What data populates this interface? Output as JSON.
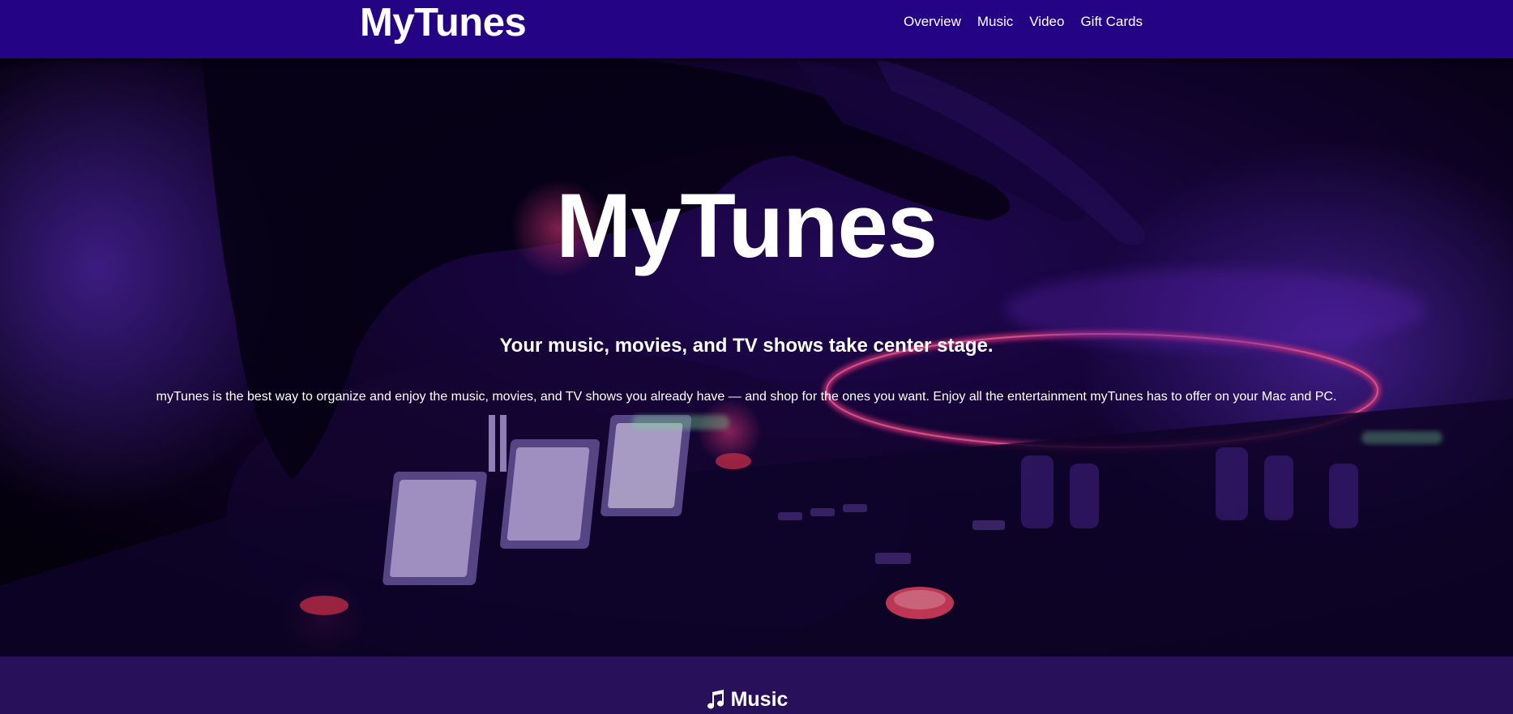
{
  "header": {
    "brand": "MyTunes",
    "nav": [
      "Overview",
      "Music",
      "Video",
      "Gift Cards"
    ]
  },
  "hero": {
    "title": "MyTunes",
    "tagline": "Your music, movies, and TV shows take center stage.",
    "description": "myTunes is the best way to organize and enjoy the music, movies, and TV shows you already have — and shop for the ones you want. Enjoy all the entertainment myTunes has to offer on your Mac and PC."
  },
  "sections": {
    "music": {
      "icon": "music-note-icon",
      "heading": "Music"
    }
  },
  "colors": {
    "navbar": "#250385",
    "music_section": "#28115a",
    "text": "#ffffff"
  }
}
